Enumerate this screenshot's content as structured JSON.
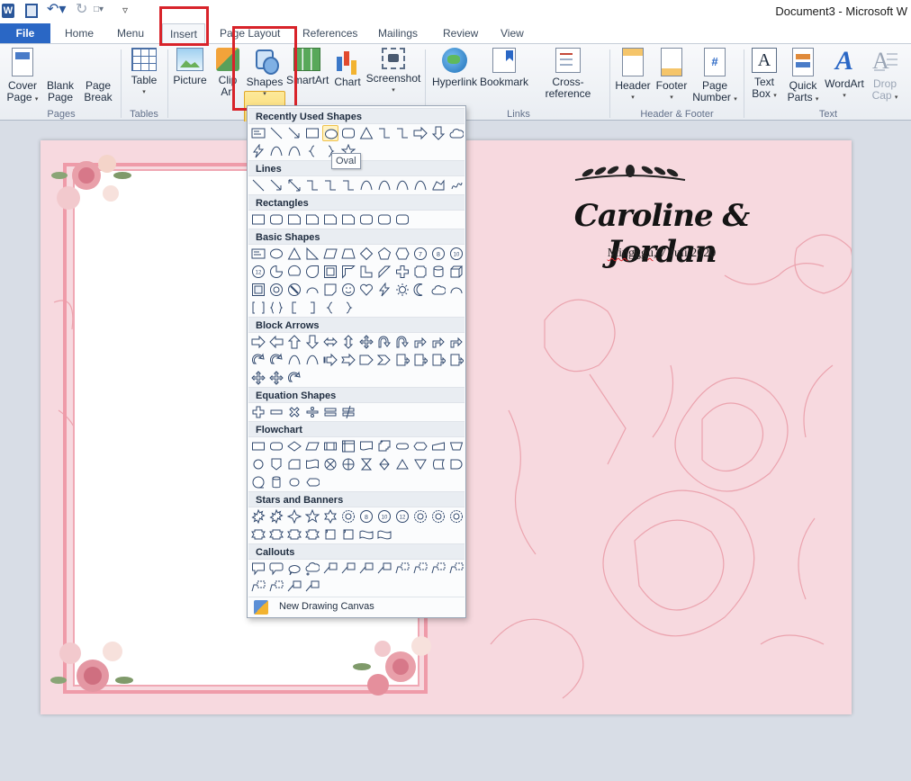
{
  "title_bar": {
    "logo": "W",
    "document_title": "Document3 - Microsoft W"
  },
  "tabs": [
    {
      "label": "File"
    },
    {
      "label": "Home"
    },
    {
      "label": "Menu"
    },
    {
      "label": "Insert"
    },
    {
      "label": "Page Layout"
    },
    {
      "label": "References"
    },
    {
      "label": "Mailings"
    },
    {
      "label": "Review"
    },
    {
      "label": "View"
    }
  ],
  "ribbon": {
    "cover_page": [
      "Cover",
      "Page"
    ],
    "blank_page": [
      "Blank",
      "Page"
    ],
    "page_break": [
      "Page",
      "Break"
    ],
    "table": "Table",
    "picture": "Picture",
    "clip_art": [
      "Clip",
      "Art"
    ],
    "shapes": "Shapes",
    "smartart": "SmartArt",
    "chart": "Chart",
    "screenshot": "Screenshot",
    "hyperlink": "Hyperlink",
    "bookmark": "Bookmark",
    "cross_reference": "Cross-reference",
    "header": "Header",
    "footer": "Footer",
    "page_number": [
      "Page",
      "Number"
    ],
    "text_box": [
      "Text",
      "Box"
    ],
    "quick_parts": [
      "Quick",
      "Parts"
    ],
    "wordart": "WordArt",
    "drop_cap": [
      "Drop",
      "Cap"
    ],
    "groups": {
      "pages": "Pages",
      "tables": "Tables",
      "links": "Links",
      "header_footer": "Header & Footer",
      "text": "Text"
    },
    "icons": {
      "textbox_letter": "A",
      "wordart_letter": "A",
      "dropcap_letter": "A",
      "pagenum_symbol": "#"
    }
  },
  "shapes_menu": {
    "sections": {
      "recent": "Recently Used Shapes",
      "lines": "Lines",
      "rectangles": "Rectangles",
      "basic": "Basic Shapes",
      "block_arrows": "Block Arrows",
      "equation": "Equation Shapes",
      "flowchart": "Flowchart",
      "stars": "Stars and Banners",
      "callouts": "Callouts"
    },
    "tooltip": "Oval",
    "new_canvas": "New Drawing Canvas"
  },
  "document": {
    "names": "Caroline & Jordan",
    "date_underlined": "Mingggu,",
    "date_rest": " 7 Juli 2020"
  }
}
